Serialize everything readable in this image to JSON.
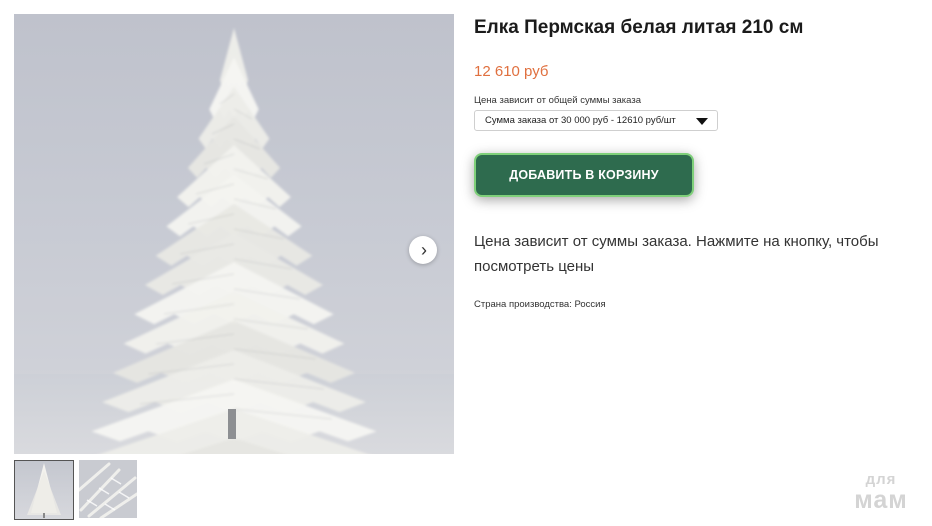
{
  "product": {
    "title": "Елка Пермская белая литая 210 см",
    "price": "12 610 руб",
    "select_label": "Цена зависит от общей суммы заказа",
    "select_value": "Сумма заказа от 30 000 руб - 12610 руб/шт",
    "cart_button": "ДОБАВИТЬ В КОРЗИНУ",
    "description": "Цена зависит от суммы заказа. Нажмите на кнопку, чтобы посмотреть цены",
    "origin": "Страна производства: Россия"
  },
  "gallery": {
    "main_image": "white-christmas-tree-photo",
    "next_icon": "chevron-right-icon",
    "thumbnails": [
      "tree-full-thumbnail",
      "branch-closeup-thumbnail"
    ],
    "active_thumbnail": 1
  },
  "watermark": {
    "line1": "для",
    "line2": "мам"
  },
  "colors": {
    "price": "#e0703f",
    "button_bg": "#2e6b4e",
    "button_border": "#7fd07a"
  }
}
